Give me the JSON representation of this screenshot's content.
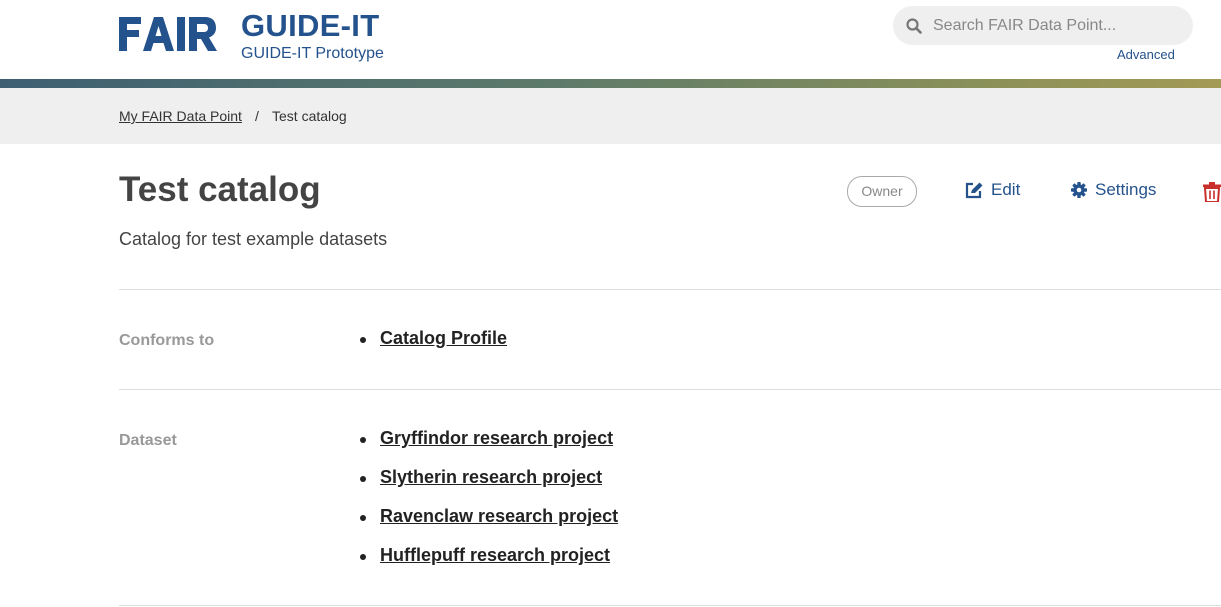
{
  "header": {
    "logo_text": "FAIR",
    "title": "GUIDE-IT",
    "subtitle": "GUIDE-IT Prototype",
    "search_placeholder": "Search FAIR Data Point...",
    "advanced_label": "Advanced",
    "brand_color": "#24528c"
  },
  "breadcrumb": {
    "root": "My FAIR Data Point",
    "separator": "/",
    "current": "Test catalog"
  },
  "catalog": {
    "title": "Test catalog",
    "description": "Catalog for test example datasets",
    "badge": "Owner",
    "actions": {
      "edit": "Edit",
      "settings": "Settings",
      "delete_icon": "trash-icon"
    }
  },
  "properties": [
    {
      "label": "Conforms to",
      "items": [
        "Catalog Profile"
      ]
    },
    {
      "label": "Dataset",
      "items": [
        "Gryffindor research project",
        "Slytherin research project",
        "Ravenclaw research project",
        "Hufflepuff research project"
      ]
    }
  ],
  "colors": {
    "accent": "#24528c",
    "danger": "#c9302c",
    "muted": "#999999"
  }
}
